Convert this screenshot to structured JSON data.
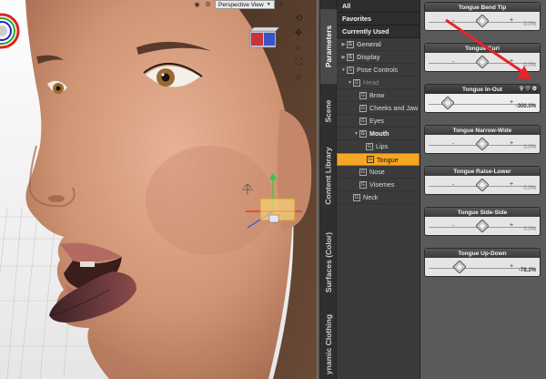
{
  "viewport": {
    "camera_label": "Perspective View",
    "tools": [
      "rotate-tool-icon",
      "pan-tool-icon",
      "zoom-tool-icon",
      "frame-tool-icon",
      "home-tool-icon"
    ]
  },
  "tabs": [
    "Parameters",
    "Scene",
    "Content Library",
    "Surfaces (Color)",
    "ynamic Clothing"
  ],
  "tree": {
    "top_items": [
      "All",
      "Favorites",
      "Currently Used"
    ],
    "rows": [
      {
        "label": "General",
        "arrow": "▶",
        "level": 0,
        "style": "cat"
      },
      {
        "label": "Display",
        "arrow": "▶",
        "level": 0,
        "style": "cat"
      },
      {
        "label": "Pose Controls",
        "arrow": "▼",
        "level": 0,
        "style": ""
      },
      {
        "label": "Head",
        "arrow": "▼",
        "level": 1,
        "style": "dim"
      },
      {
        "label": "Brow",
        "arrow": "",
        "level": 2,
        "style": ""
      },
      {
        "label": "Cheeks and Jaw",
        "arrow": "",
        "level": 2,
        "style": ""
      },
      {
        "label": "Eyes",
        "arrow": "",
        "level": 2,
        "style": ""
      },
      {
        "label": "Mouth",
        "arrow": "▼",
        "level": 2,
        "style": "bold"
      },
      {
        "label": "Lips",
        "arrow": "",
        "level": 3,
        "style": ""
      },
      {
        "label": "Tongue",
        "arrow": "",
        "level": 3,
        "style": "sel"
      },
      {
        "label": "Nose",
        "arrow": "",
        "level": 2,
        "style": ""
      },
      {
        "label": "Visemes",
        "arrow": "",
        "level": 2,
        "style": ""
      },
      {
        "label": "Neck",
        "arrow": "",
        "level": 1,
        "style": ""
      }
    ]
  },
  "params": [
    {
      "name": "Tongue Bend Tip",
      "value": "0.0%",
      "pos": 0.5
    },
    {
      "name": "Tongue Curl",
      "value": "0.0%",
      "pos": 0.5
    },
    {
      "name": "Tongue In-Out",
      "value": "-300.0%",
      "pos": 0.2,
      "active": true
    },
    {
      "name": "Tongue Narrow-Wide",
      "value": "0.0%",
      "pos": 0.5
    },
    {
      "name": "Tongue Raise-Lower",
      "value": "0.0%",
      "pos": 0.5
    },
    {
      "name": "Tongue Side-Side",
      "value": "0.0%",
      "pos": 0.5
    },
    {
      "name": "Tongue Up-Down",
      "value": "-78.2%",
      "pos": 0.3
    }
  ],
  "colors": {
    "selection": "#f5a623",
    "annotation_arrow": "#e8242a"
  }
}
